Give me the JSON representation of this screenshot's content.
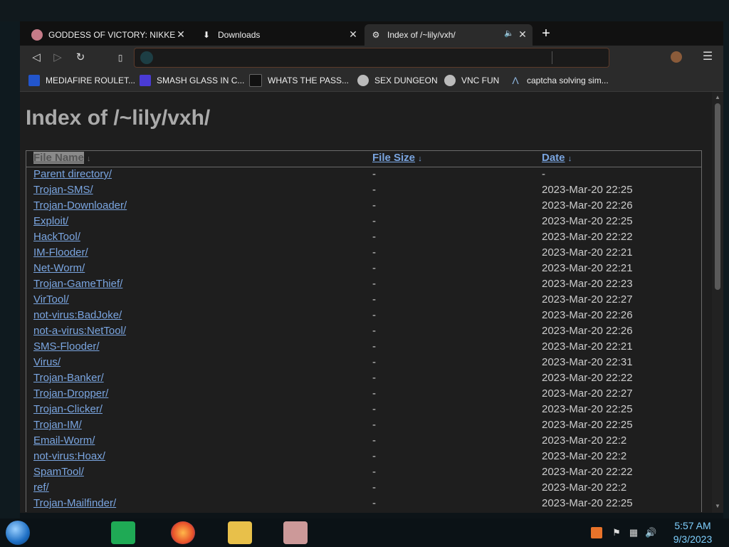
{
  "tabs": [
    {
      "label": "GODDESS OF VICTORY: NIKKE | Im",
      "icon": "nikke-favicon-icon"
    },
    {
      "label": "Downloads",
      "icon": "download-icon"
    },
    {
      "label": "Index of /~lily/vxh/",
      "icon": "site-favicon-icon",
      "audio": "speaker-icon"
    }
  ],
  "toolbar": {
    "url_value": "",
    "back": "◁",
    "forward": "▷",
    "reload": "↻",
    "bookmark": "🔖",
    "menu": "☰"
  },
  "bookmarks": [
    {
      "label": "MEDIAFIRE ROULET...",
      "color": "#2255cc"
    },
    {
      "label": "SMASH GLASS IN C...",
      "color": "#4a3bd6"
    },
    {
      "label": "WHATS THE PASS...",
      "color": "#111111"
    },
    {
      "label": "SEX DUNGEON",
      "color": "#bbbbbb"
    },
    {
      "label": "VNC FUN",
      "color": "#bbbbbb"
    },
    {
      "label": "captcha solving sim...",
      "color": "#8ab0d8"
    }
  ],
  "page": {
    "title": "Index of /~lily/vxh/",
    "headers": {
      "name": "File Name",
      "size": "File Size",
      "date": "Date",
      "sort_arrow": "↓"
    },
    "rows": [
      {
        "name": "Parent directory/",
        "size": "-",
        "date": "-"
      },
      {
        "name": "Trojan-SMS/",
        "size": "-",
        "date": "2023-Mar-20 22:25"
      },
      {
        "name": "Trojan-Downloader/",
        "size": "-",
        "date": "2023-Mar-20 22:26"
      },
      {
        "name": "Exploit/",
        "size": "-",
        "date": "2023-Mar-20 22:25"
      },
      {
        "name": "HackTool/",
        "size": "-",
        "date": "2023-Mar-20 22:22"
      },
      {
        "name": "IM-Flooder/",
        "size": "-",
        "date": "2023-Mar-20 22:21"
      },
      {
        "name": "Net-Worm/",
        "size": "-",
        "date": "2023-Mar-20 22:21"
      },
      {
        "name": "Trojan-GameThief/",
        "size": "-",
        "date": "2023-Mar-20 22:23"
      },
      {
        "name": "VirTool/",
        "size": "-",
        "date": "2023-Mar-20 22:27"
      },
      {
        "name": "not-virus:BadJoke/",
        "size": "-",
        "date": "2023-Mar-20 22:26"
      },
      {
        "name": "not-a-virus:NetTool/",
        "size": "-",
        "date": "2023-Mar-20 22:26"
      },
      {
        "name": "SMS-Flooder/",
        "size": "-",
        "date": "2023-Mar-20 22:21"
      },
      {
        "name": "Virus/",
        "size": "-",
        "date": "2023-Mar-20 22:31"
      },
      {
        "name": "Trojan-Banker/",
        "size": "-",
        "date": "2023-Mar-20 22:22"
      },
      {
        "name": "Trojan-Dropper/",
        "size": "-",
        "date": "2023-Mar-20 22:27"
      },
      {
        "name": "Trojan-Clicker/",
        "size": "-",
        "date": "2023-Mar-20 22:25"
      },
      {
        "name": "Trojan-IM/",
        "size": "-",
        "date": "2023-Mar-20 22:25"
      },
      {
        "name": "Email-Worm/",
        "size": "-",
        "date": "2023-Mar-20 22:2"
      },
      {
        "name": "not-virus:Hoax/",
        "size": "-",
        "date": "2023-Mar-20 22:2"
      },
      {
        "name": "SpamTool/",
        "size": "-",
        "date": "2023-Mar-20 22:22"
      },
      {
        "name": "ref/",
        "size": "-",
        "date": "2023-Mar-20 22:2"
      },
      {
        "name": "Trojan-Mailfinder/",
        "size": "-",
        "date": "2023-Mar-20 22:25"
      }
    ]
  },
  "taskbar": {
    "apps": [
      {
        "name": "spotify-like-app",
        "color": "#1faa55"
      },
      {
        "name": "firefox",
        "color": "#e8732a"
      },
      {
        "name": "file-explorer",
        "color": "#e8c04a"
      },
      {
        "name": "anime-app",
        "color": "#c99"
      }
    ],
    "clock_time": "5:57 AM",
    "clock_date": "9/3/2023"
  }
}
